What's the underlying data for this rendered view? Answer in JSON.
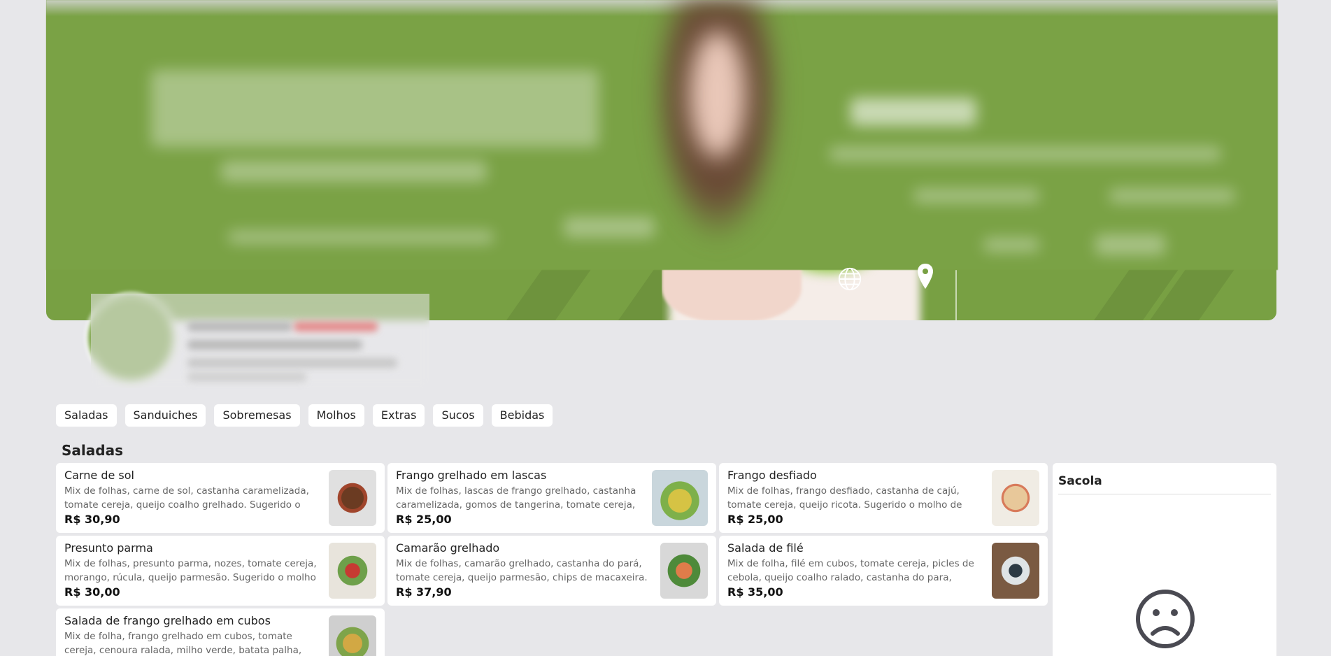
{
  "tabs": [
    "Saladas",
    "Sanduiches",
    "Sobremesas",
    "Molhos",
    "Extras",
    "Sucos",
    "Bebidas"
  ],
  "section": {
    "title": "Saladas"
  },
  "products": [
    {
      "name": "Carne de sol",
      "description": "Mix de folhas, carne de sol, castanha caramelizada, tomate cereja, queijo coalho grelhado. Sugerido o molho de",
      "price": "R$ 30,90"
    },
    {
      "name": "Frango grelhado em lascas",
      "description": "Mix de folhas, lascas de frango grelhado, castanha caramelizada, gomos de tangerina, tomate cereja, rúcula,",
      "price": "R$ 25,00"
    },
    {
      "name": "Frango desfiado",
      "description": "Mix de folhas, frango desfiado, castanha de cajú, tomate cereja, queijo ricota. Sugerido o molho de iogurte com",
      "price": "R$ 25,00"
    },
    {
      "name": "Presunto parma",
      "description": "Mix de folhas, presunto parma, nozes, tomate cereja, morango, rúcula, queijo parmesão. Sugerido o molho de",
      "price": "R$ 30,00"
    },
    {
      "name": "Camarão grelhado",
      "description": "Mix de folhas, camarão grelhado, castanha do pará, tomate cereja, queijo parmesão, chips de macaxeira. Sugerido o",
      "price": "R$ 37,90"
    },
    {
      "name": "Salada de filé",
      "description": "Mix de folha, filé em cubos, tomate cereja, picles de cebola, queijo coalho ralado, castanha do para, croutons.",
      "price": "R$ 35,00"
    },
    {
      "name": "Salada de frango grelhado em cubos",
      "description": "Mix de folha, frango grelhado em cubos, tomate cereja, cenoura ralada, milho verde, batata palha, ovos de codorna.",
      "price": ""
    }
  ],
  "bag": {
    "title": "Sacola",
    "empty_icon": "sad-face-icon"
  },
  "banner": {
    "icons": [
      "globe-icon",
      "location-pin-icon"
    ]
  },
  "colors": {
    "brand_green": "#78a043",
    "background": "#e7e7ea"
  }
}
